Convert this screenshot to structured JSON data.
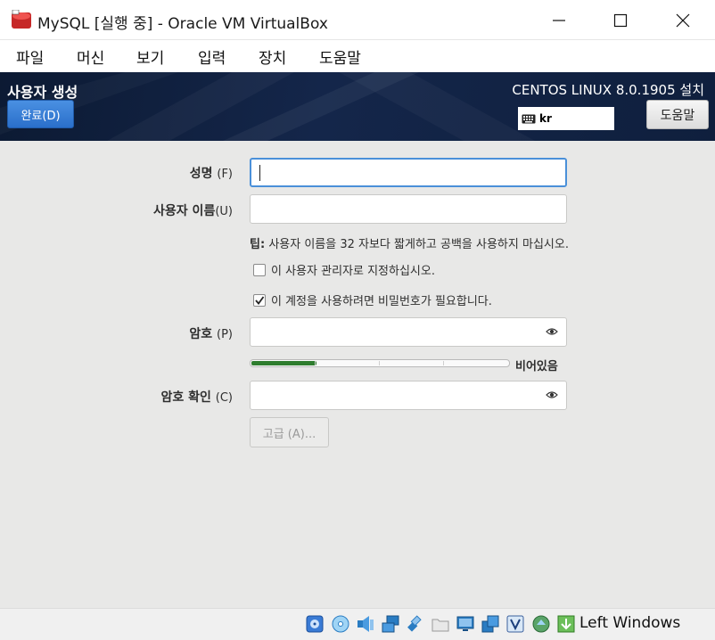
{
  "window": {
    "title": "MySQL [실행 중] - Oracle VM VirtualBox",
    "controls": [
      "minimize-icon",
      "maximize-icon",
      "close-icon"
    ]
  },
  "menu": {
    "items": [
      {
        "label": "파일"
      },
      {
        "label": "머신"
      },
      {
        "label": "보기"
      },
      {
        "label": "입력"
      },
      {
        "label": "장치"
      },
      {
        "label": "도움말"
      }
    ]
  },
  "header": {
    "spoke_title": "사용자 생성",
    "done_label": "완료(D)",
    "product_title": "CENTOS LINUX 8.0.1905 설치",
    "keyboard_layout": "kr",
    "help_label": "도움말"
  },
  "form": {
    "fullname": {
      "label": "성명",
      "mnemonic": "(F)",
      "value": ""
    },
    "username": {
      "label": "사용자 이름",
      "mnemonic": "(U)",
      "value": ""
    },
    "hint_prefix": "팁:",
    "hint_text": "사용자 이름을 32 자보다 짧게하고 공백을 사용하지 마십시오.",
    "admin_check": {
      "label": "이 사용자 관리자로 지정하십시오.",
      "checked": false
    },
    "password_required_check": {
      "label": "이 계정을 사용하려면 비밀번호가 필요합니다.",
      "checked": true
    },
    "password": {
      "label": "암호",
      "mnemonic": "(P)",
      "value": ""
    },
    "strength": {
      "label": "비어있음",
      "fraction": 0.25
    },
    "confirm": {
      "label": "암호 확인",
      "mnemonic": "(C)",
      "value": ""
    },
    "advanced_label": "고급 (A)..."
  },
  "statusbar": {
    "icons": [
      "hard-disk-icon",
      "optical-disk-icon",
      "audio-icon",
      "network-icon",
      "usb-icon",
      "shared-folder-icon",
      "display-icon",
      "capture-icon",
      "vt-x-icon",
      "mouse-integration-icon",
      "keyboard-capture-icon"
    ],
    "host_key": "Left Windows"
  },
  "colors": {
    "header_bg": "#14264a",
    "done_button": "#3b82d6",
    "content_bg": "#e8e8e7",
    "focus_border": "#4a90d9",
    "strength_fill": "#2e7d2e"
  }
}
